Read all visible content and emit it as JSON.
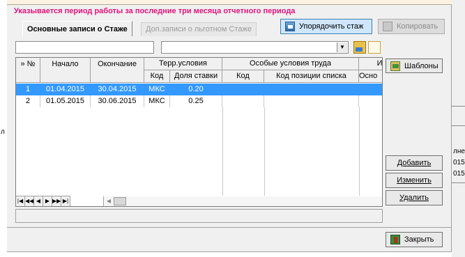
{
  "window": {
    "notice": "Указывается период работы за последние три месяца отчетного периода"
  },
  "tabs": [
    {
      "label": "Основные записи о Стаже",
      "active": true
    },
    {
      "label": "Доп.записи о льготном Стаже",
      "active": false
    }
  ],
  "toolbar": {
    "order_label": "Упорядочить стаж",
    "copy_label": "Копировать"
  },
  "filters": {
    "text_value": "",
    "select_value": ""
  },
  "table": {
    "headers": {
      "num": "» №",
      "start": "Начало",
      "end": "Окончание",
      "terr_group": "Терр.условия",
      "terr_code": "Код",
      "terr_rate": "Доля ставки",
      "special_group": "Особые условия труда",
      "special_code": "Код",
      "special_pos": "Код позиции списка",
      "source_group": "Ис",
      "source_base": "Осно"
    },
    "rows": [
      {
        "num": "1",
        "start": "01.04.2015",
        "end": "30.04.2015",
        "terr_code": "МКС",
        "rate": "0.20",
        "selected": true
      },
      {
        "num": "2",
        "start": "01.05.2015",
        "end": "30.06.2015",
        "terr_code": "МКС",
        "rate": "0.25",
        "selected": false
      }
    ]
  },
  "side_buttons": {
    "templates": "Шаблоны",
    "add": "Добавить",
    "edit": "Изменить",
    "delete": "Удалить",
    "close": "Закрыть"
  },
  "background_fragments": {
    "left": "л",
    "right_header": "лне",
    "right_row1": "015",
    "right_row2": "015"
  },
  "colors": {
    "notice": "#e0137a",
    "selection": "#3399ff",
    "dialog_bg": "#f0f0f0"
  }
}
